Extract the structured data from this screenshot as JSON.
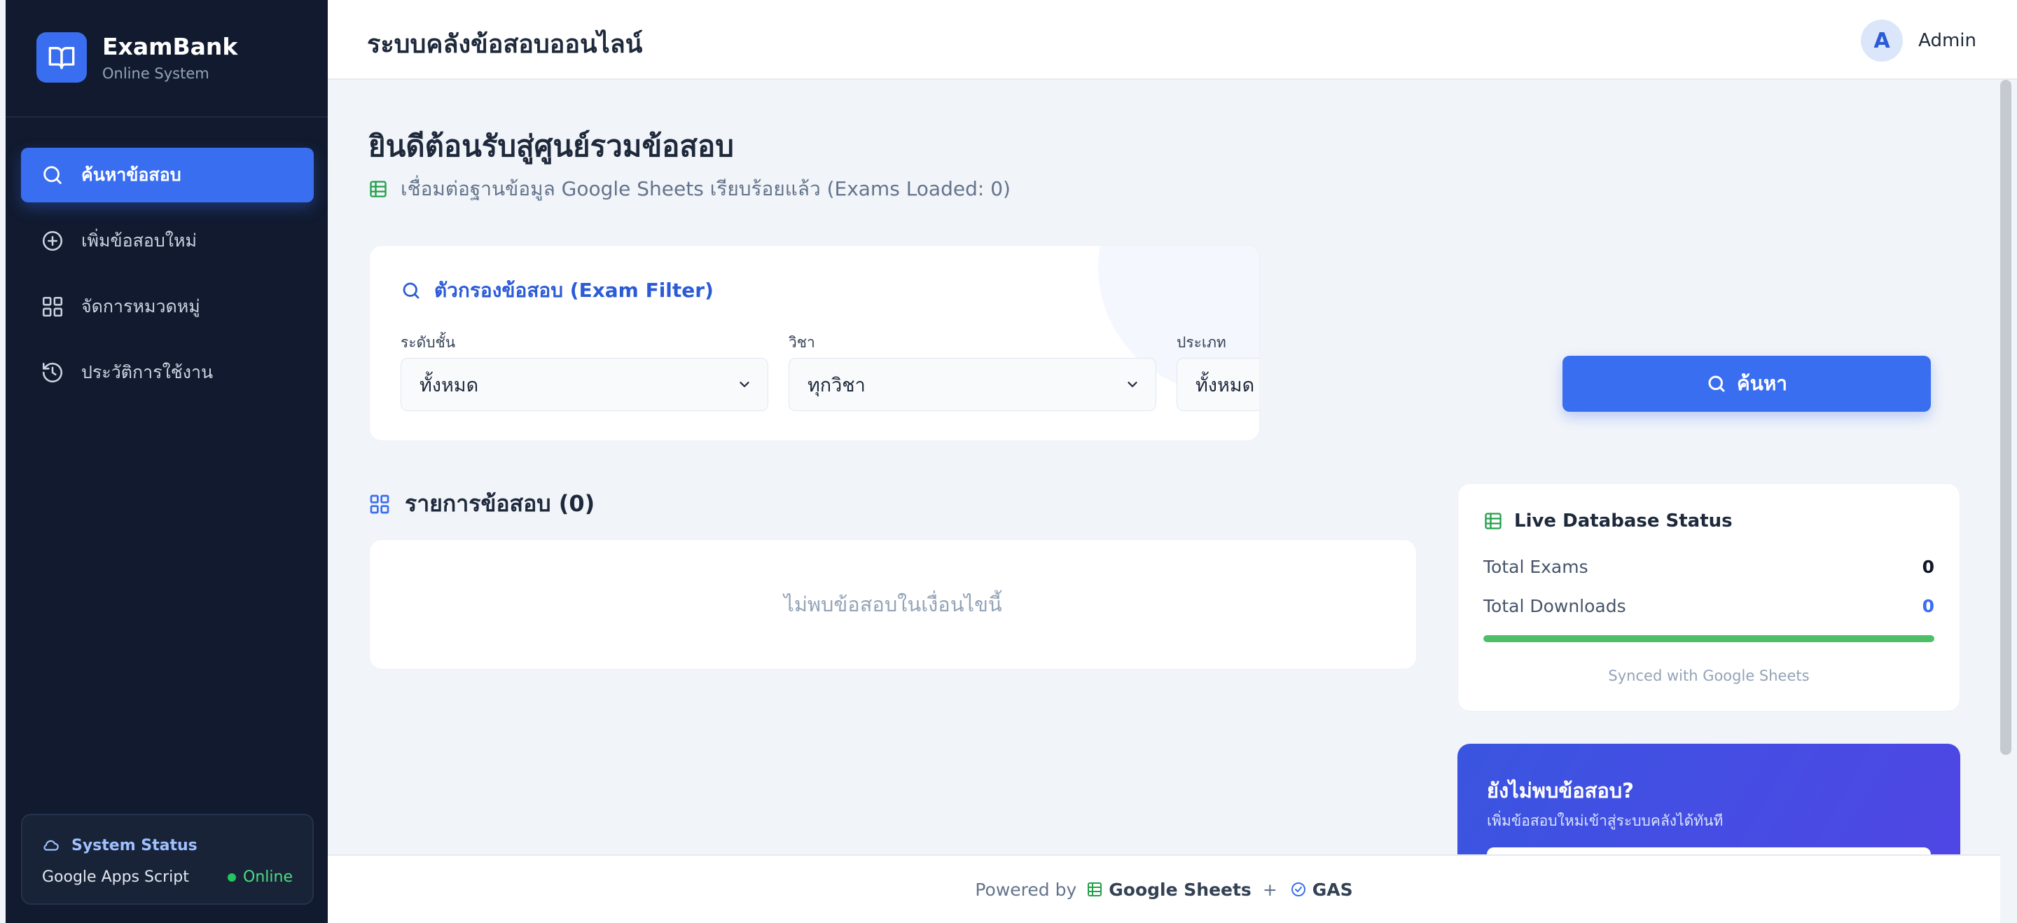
{
  "sidebar": {
    "brand": {
      "name": "ExamBank",
      "subtitle": "Online System",
      "icon": "book-open-icon"
    },
    "nav": [
      {
        "label": "ค้นหาข้อสอบ",
        "icon": "search-icon",
        "active": true
      },
      {
        "label": "เพิ่มข้อสอบใหม่",
        "icon": "plus-circle-icon",
        "active": false
      },
      {
        "label": "จัดการหมวดหมู่",
        "icon": "grid-icon",
        "active": false
      },
      {
        "label": "ประวัติการใช้งาน",
        "icon": "history-icon",
        "active": false
      }
    ],
    "status": {
      "title": "System Status",
      "source": "Google Apps Script",
      "state": "Online",
      "icon": "cloud-icon"
    }
  },
  "header": {
    "title": "ระบบคลังข้อสอบออนไลน์",
    "user": {
      "avatar_letter": "A",
      "name": "Admin"
    }
  },
  "main": {
    "welcome": "ยินดีต้อนรับสู่ศูนย์รวมข้อสอบ",
    "connection": "เชื่อมต่อฐานข้อมูล Google Sheets เรียบร้อยแล้ว (Exams Loaded: 0)",
    "filter": {
      "title": "ตัวกรองข้อสอบ (Exam Filter)",
      "fields": [
        {
          "label": "ระดับชั้น",
          "value": "ทั้งหมด"
        },
        {
          "label": "วิชา",
          "value": "ทุกวิชา"
        },
        {
          "label": "ประเภท",
          "value": "ทั้งหมด"
        }
      ],
      "search_label": "ค้นหา"
    },
    "list": {
      "title": "รายการข้อสอบ (0)",
      "empty_message": "ไม่พบข้อสอบในเงื่อนไขนี้"
    }
  },
  "live_status": {
    "title": "Live Database Status",
    "rows": [
      {
        "label": "Total Exams",
        "value": "0"
      },
      {
        "label": "Total Downloads",
        "value": "0"
      }
    ],
    "progress": 1.0,
    "synced_text": "Synced with Google Sheets"
  },
  "promo": {
    "title": "ยังไม่พบข้อสอบ?",
    "subtitle": "เพิ่มข้อสอบใหม่เข้าสู่ระบบคลังได้ทันที"
  },
  "footer": {
    "powered_by": "Powered by",
    "sheets": "Google Sheets",
    "plus": "+",
    "gas": "GAS"
  },
  "colors": {
    "sidebar_bg": "#111a2e",
    "accent": "#3a6ef0",
    "online_green": "#22c55e",
    "sheets_green": "#4fbf67"
  }
}
